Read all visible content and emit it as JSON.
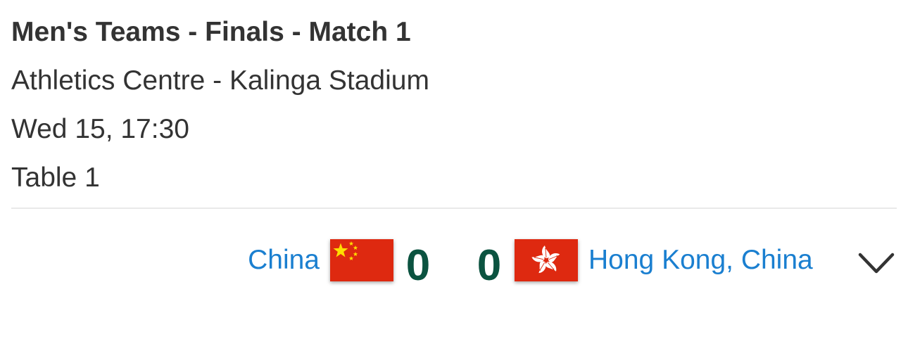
{
  "match": {
    "title": "Men's Teams - Finals - Match 1",
    "venue": "Athletics Centre - Kalinga Stadium",
    "datetime": "Wed 15, 17:30",
    "table": "Table 1"
  },
  "home": {
    "name": "China",
    "score": "0",
    "flag_icon": "china-flag-icon"
  },
  "away": {
    "name": "Hong Kong, China",
    "score": "0",
    "flag_icon": "hong-kong-flag-icon"
  },
  "colors": {
    "link": "#1a7fd0",
    "score": "#0b5340",
    "text": "#333333",
    "flag_red": "#de2910",
    "flag_yellow": "#ffde00"
  }
}
